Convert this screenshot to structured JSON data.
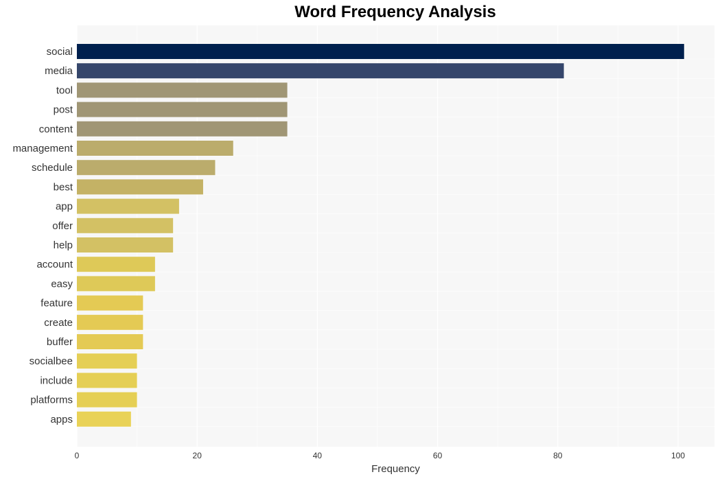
{
  "chart_data": {
    "type": "bar",
    "orientation": "horizontal",
    "title": "Word Frequency Analysis",
    "xlabel": "Frequency",
    "ylabel": "",
    "xlim": [
      0,
      106
    ],
    "xticks": [
      0,
      20,
      40,
      60,
      80,
      100
    ],
    "grid": true,
    "categories": [
      "social",
      "media",
      "tool",
      "post",
      "content",
      "management",
      "schedule",
      "best",
      "app",
      "offer",
      "help",
      "account",
      "easy",
      "feature",
      "create",
      "buffer",
      "socialbee",
      "include",
      "platforms",
      "apps"
    ],
    "values": [
      101,
      81,
      35,
      35,
      35,
      26,
      23,
      21,
      17,
      16,
      16,
      13,
      13,
      11,
      11,
      11,
      10,
      10,
      10,
      9
    ],
    "colors": [
      "#00204e",
      "#35466b",
      "#a09675",
      "#a09675",
      "#a09675",
      "#bbac6c",
      "#bbac6c",
      "#c4b265",
      "#d3c164",
      "#d3c164",
      "#d3c164",
      "#dec958",
      "#dec958",
      "#e4ca54",
      "#e4ca54",
      "#e4ca54",
      "#e5cf55",
      "#e5cf55",
      "#e5cf55",
      "#e9d257"
    ]
  }
}
